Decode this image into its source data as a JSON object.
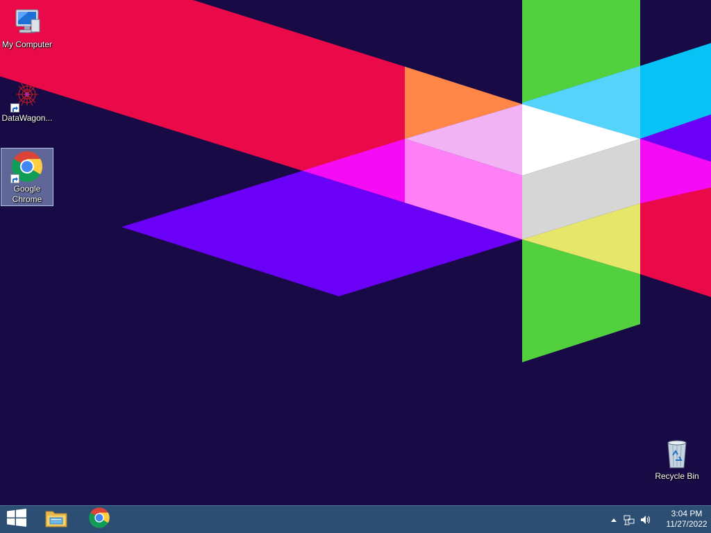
{
  "desktop": {
    "icons": [
      {
        "label": "My Computer",
        "icon": "computer-icon"
      },
      {
        "label": "DataWagon...",
        "icon": "datawagon-icon"
      },
      {
        "label": "Google Chrome",
        "icon": "chrome-icon"
      },
      {
        "label": "Recycle Bin",
        "icon": "recycle-bin-icon"
      }
    ]
  },
  "taskbar": {
    "start_icon": "windows-logo-icon",
    "pinned": [
      {
        "name": "File Explorer",
        "icon": "file-explorer-icon"
      },
      {
        "name": "Google Chrome",
        "icon": "chrome-icon"
      }
    ],
    "tray": {
      "show_hidden_icon": "chevron-up-icon",
      "network_icon": "network-icon",
      "volume_icon": "volume-icon",
      "time": "3:04 PM",
      "date": "11/27/2022"
    }
  },
  "colors": {
    "background": "#170a45",
    "taskbar": "#2c4e72",
    "red": "#ea0a4a",
    "orange": "#ff8647",
    "green": "#52d03d",
    "cyan": "#07c2f5",
    "violet": "#6b00f6",
    "magenta": "#f50bf4"
  }
}
